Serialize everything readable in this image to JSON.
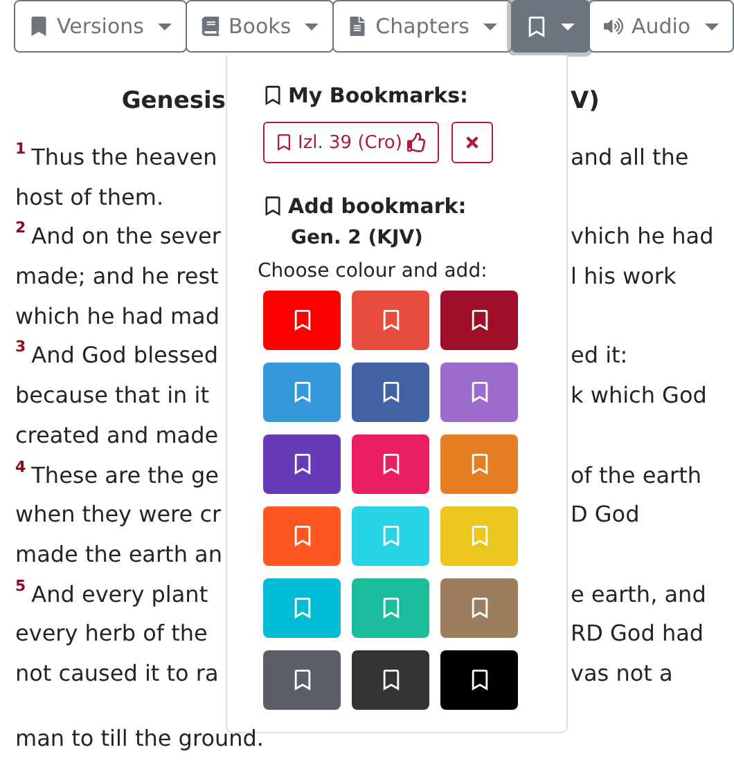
{
  "toolbar": [
    {
      "kind": "versions",
      "label": "Versions",
      "active": false
    },
    {
      "kind": "books",
      "label": "Books",
      "active": false
    },
    {
      "kind": "chapters",
      "label": "Chapters",
      "active": false
    },
    {
      "kind": "bookmarks",
      "active": true
    },
    {
      "kind": "audio",
      "label": "Audio",
      "active": false
    }
  ],
  "heading": {
    "left": "Genesis",
    "right": "V)"
  },
  "lines": [
    {
      "verse": "1",
      "left": "Thus the heaven",
      "right": "and all the"
    },
    {
      "left": "host of them."
    },
    {
      "verse": "2",
      "left": "And on the sever",
      "right": "vhich he had"
    },
    {
      "left": "made; and he rest",
      "right": "l his work"
    },
    {
      "left": "which he had mad"
    },
    {
      "verse": "3",
      "left": "And God blessed",
      "right": "ed it:"
    },
    {
      "left": "because that in it",
      "right": "k which God"
    },
    {
      "left": "created and made"
    },
    {
      "verse": "4",
      "left": "These are the ge",
      "right": "of the earth"
    },
    {
      "left": "when they were cr",
      "right": "D God"
    },
    {
      "left": "made the earth an"
    },
    {
      "verse": "5",
      "left": "And every plant",
      "right": "e earth, and"
    },
    {
      "left": "every herb of the",
      "right": "RD God had"
    },
    {
      "left": "not caused it to ra",
      "right": "vas not a"
    }
  ],
  "last_line": "man to till the ground.",
  "popover": {
    "my_bookmarks_title": "My Bookmarks:",
    "bookmarks": [
      {
        "label": "Izl. 39 (Cro)"
      }
    ],
    "add_title": "Add bookmark:",
    "add_reference": "Gen. 2 (KJV)",
    "choose_label": "Choose colour and add:",
    "colours": [
      {
        "color": "#ff0000"
      },
      {
        "color": "#e74c3c"
      },
      {
        "color": "#9e0e28"
      },
      {
        "color": "#3498db"
      },
      {
        "color": "#4262a3"
      },
      {
        "color": "#9b6ccc"
      },
      {
        "color": "#673ab7"
      },
      {
        "color": "#e91e63"
      },
      {
        "color": "#e67e22"
      },
      {
        "color": "#ff5722"
      },
      {
        "color": "#26d4e3"
      },
      {
        "color": "#eac61e"
      },
      {
        "color": "#00bcd4"
      },
      {
        "color": "#1abc9c"
      },
      {
        "color": "#9c7e5f"
      },
      {
        "color": "#5a5e66"
      },
      {
        "color": "#333333"
      },
      {
        "color": "#000000"
      }
    ]
  }
}
